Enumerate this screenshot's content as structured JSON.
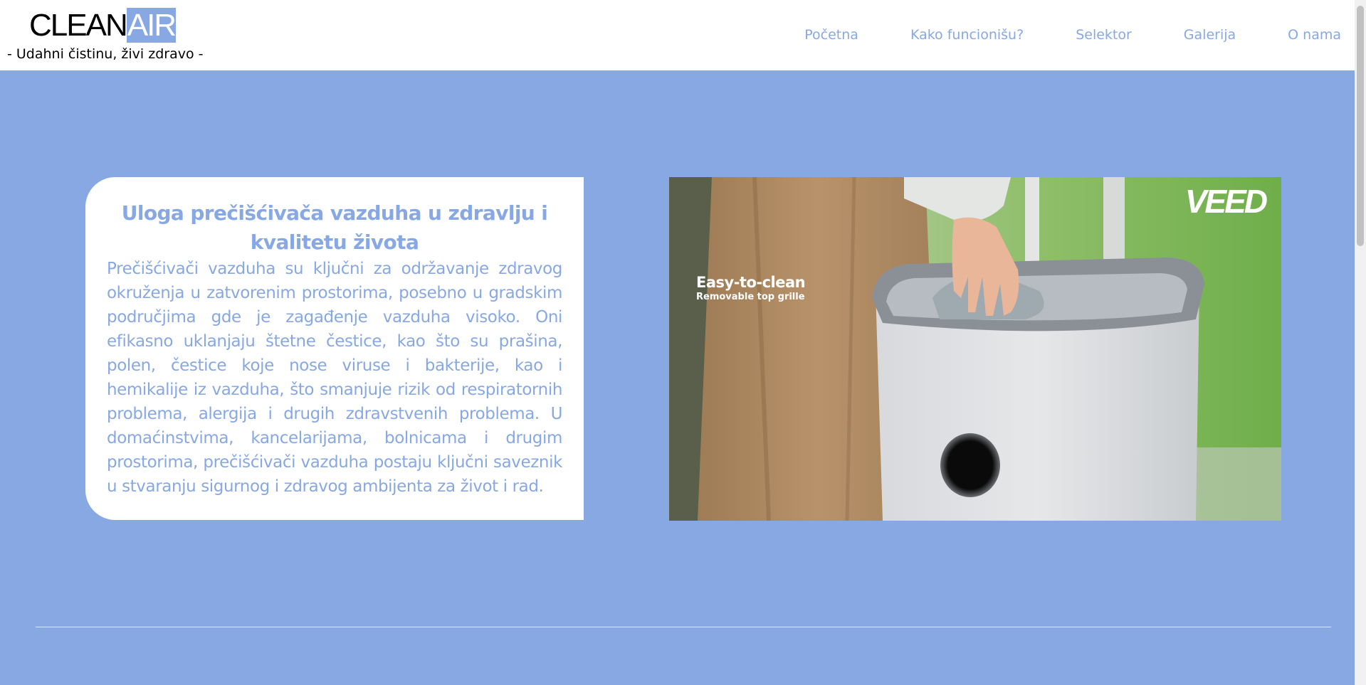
{
  "header": {
    "logo_clean": "CLEAN",
    "logo_air": "AIR",
    "tagline": "- Udahni čistinu, živi zdravo -",
    "nav": [
      {
        "label": "Početna"
      },
      {
        "label": "Kako funcionišu?"
      },
      {
        "label": "Selektor"
      },
      {
        "label": "Galerija"
      },
      {
        "label": "O nama"
      }
    ]
  },
  "main": {
    "card": {
      "title": "Uloga prečišćivača vazduha u zdravlju i kvalitetu života",
      "text": "Prečišćivači vazduha su ključni za održavanje zdravog okruženja u zatvorenim prostorima, posebno u gradskim područjima gde je zagađenje vazduha visoko. Oni efikasno uklanjaju štetne čestice, kao što su prašina, polen, čestice koje nose viruse i bakterije, kao i hemikalije iz vazduha, što smanjuje rizik od respiratornih problema, alergija i drugih zdravstvenih problema. U domaćinstvima, kancelarijama, bolnicama i drugim prostorima, prečišćivači vazduha postaju ključni saveznik u stvaranju sigurnog i zdravog ambijenta za život i rad."
    },
    "video": {
      "watermark": "VEED",
      "caption_title": "Easy-to-clean",
      "caption_subtitle": "Removable top grille"
    }
  },
  "colors": {
    "accent": "#88a8e4",
    "background": "#88a8e4",
    "card_bg": "#ffffff",
    "header_bg": "#ffffff"
  }
}
